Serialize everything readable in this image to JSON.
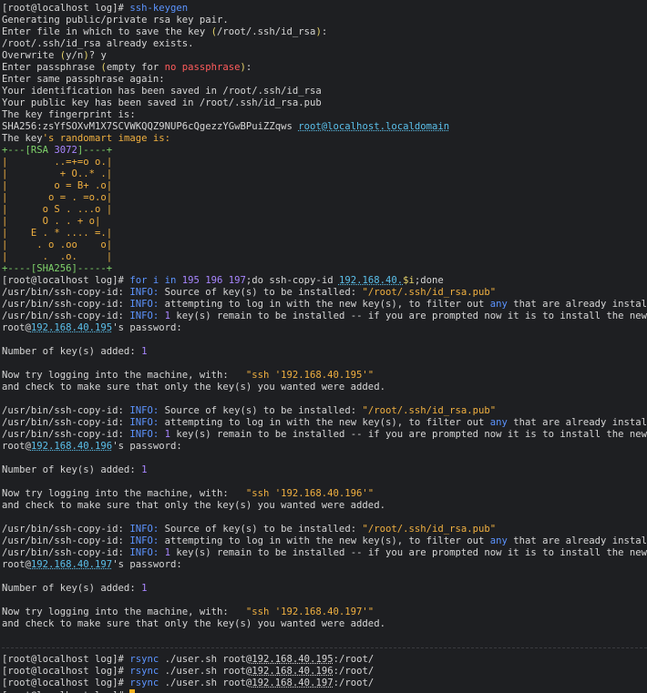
{
  "terminal": {
    "background": "#1e1f22",
    "prompt": "[root@localhost log]#",
    "colors": {
      "command": "#5c94ff",
      "info": "#5c94ff",
      "number": "#a886ff",
      "string": "#f0b040",
      "url": "#5bc0eb",
      "error": "#ff5c5c",
      "cursor": "#f2b01e"
    }
  },
  "lines": [
    {
      "kind": "text",
      "segments": [
        {
          "t": "[root@localhost log]# "
        },
        {
          "t": "ssh-keygen",
          "c": "blue"
        }
      ]
    },
    {
      "kind": "text",
      "segments": [
        {
          "t": "Generating public/private rsa key pair."
        }
      ]
    },
    {
      "kind": "text",
      "segments": [
        {
          "t": "Enter file in which to save the key "
        },
        {
          "t": "(",
          "c": "yellow"
        },
        {
          "t": "/root/.ssh/id_rsa"
        },
        {
          "t": ")",
          "c": "yellow"
        },
        {
          "t": ":"
        }
      ]
    },
    {
      "kind": "text",
      "segments": [
        {
          "t": "/root/.ssh/id_rsa already exists."
        }
      ]
    },
    {
      "kind": "text",
      "segments": [
        {
          "t": "Overwrite "
        },
        {
          "t": "(",
          "c": "yellow"
        },
        {
          "t": "y/n"
        },
        {
          "t": ")",
          "c": "yellow"
        },
        {
          "t": "? y"
        }
      ]
    },
    {
      "kind": "text",
      "segments": [
        {
          "t": "Enter passphrase "
        },
        {
          "t": "(",
          "c": "yellow"
        },
        {
          "t": "empty for "
        },
        {
          "t": "no passphrase",
          "c": "red"
        },
        {
          "t": ")",
          "c": "yellow"
        },
        {
          "t": ":"
        }
      ]
    },
    {
      "kind": "text",
      "segments": [
        {
          "t": "Enter same passphrase again:"
        }
      ]
    },
    {
      "kind": "text",
      "segments": [
        {
          "t": "Your identification has been saved in /root/.ssh/id_rsa"
        }
      ]
    },
    {
      "kind": "text",
      "segments": [
        {
          "t": "Your public key has been saved in /root/.ssh/id_rsa.pub"
        }
      ]
    },
    {
      "kind": "text",
      "segments": [
        {
          "t": "The key fingerprint is:"
        }
      ]
    },
    {
      "kind": "text",
      "segments": [
        {
          "t": "SHA256:zsYfSOXvM1X7SCVWKQQZ9NUP6cQgezzYGwBPuiZZqws "
        },
        {
          "t": "root@localhost.localdomain",
          "c": "cyan",
          "u": true
        }
      ]
    },
    {
      "kind": "text",
      "segments": [
        {
          "t": "The key"
        },
        {
          "t": "'s randomart image is:",
          "c": "orange"
        }
      ]
    },
    {
      "kind": "text",
      "segments": [
        {
          "t": "+---[RSA ",
          "c": "green"
        },
        {
          "t": "3072",
          "c": "purple"
        },
        {
          "t": "]----+",
          "c": "green"
        }
      ]
    },
    {
      "kind": "text",
      "segments": [
        {
          "t": "|",
          "c": "orange"
        },
        {
          "t": "        ..=+=o o.|",
          "c": "orange"
        }
      ]
    },
    {
      "kind": "text",
      "segments": [
        {
          "t": "|         + O..* .|",
          "c": "orange"
        }
      ]
    },
    {
      "kind": "text",
      "segments": [
        {
          "t": "|        o = B+ .o|",
          "c": "orange"
        }
      ]
    },
    {
      "kind": "text",
      "segments": [
        {
          "t": "|       o = . =o.o|",
          "c": "orange"
        }
      ]
    },
    {
      "kind": "text",
      "segments": [
        {
          "t": "|      o S . ...o |",
          "c": "orange"
        }
      ]
    },
    {
      "kind": "text",
      "segments": [
        {
          "t": "|      O . . + o|",
          "c": "orange"
        }
      ]
    },
    {
      "kind": "text",
      "segments": [
        {
          "t": "|    E . * .... =.|",
          "c": "orange"
        }
      ]
    },
    {
      "kind": "text",
      "segments": [
        {
          "t": "|     . o .oo    o|",
          "c": "orange"
        }
      ]
    },
    {
      "kind": "text",
      "segments": [
        {
          "t": "|      .  .o.     |",
          "c": "orange"
        }
      ]
    },
    {
      "kind": "text",
      "segments": [
        {
          "t": "+----[SHA256]-----+",
          "c": "green"
        }
      ]
    },
    {
      "kind": "text",
      "segments": [
        {
          "t": "[root@localhost log]# "
        },
        {
          "t": "for i in ",
          "c": "blue"
        },
        {
          "t": "195 196 197",
          "c": "purple"
        },
        {
          "t": ";do ssh-copy-id "
        },
        {
          "t": "192.168.40.",
          "c": "cyan",
          "u": true
        },
        {
          "t": "$i",
          "c": "yellow"
        },
        {
          "t": ";done"
        }
      ]
    },
    {
      "kind": "text",
      "segments": [
        {
          "t": "/usr/bin/ssh-copy-id: "
        },
        {
          "t": "INFO:",
          "c": "blue"
        },
        {
          "t": " Source of key(s) to be installed: "
        },
        {
          "t": "\"/root/.ssh/id_rsa.pub\"",
          "c": "orange"
        }
      ]
    },
    {
      "kind": "text",
      "segments": [
        {
          "t": "/usr/bin/ssh-copy-id: "
        },
        {
          "t": "INFO:",
          "c": "blue"
        },
        {
          "t": " attempting to log in with the new key(s), to filter out "
        },
        {
          "t": "any",
          "c": "blue"
        },
        {
          "t": " that are already installed"
        }
      ]
    },
    {
      "kind": "text",
      "segments": [
        {
          "t": "/usr/bin/ssh-copy-id: "
        },
        {
          "t": "INFO:",
          "c": "blue"
        },
        {
          "t": " "
        },
        {
          "t": "1",
          "c": "purple"
        },
        {
          "t": " key(s) remain to be installed -- if you are prompted now it is to install the new keys"
        }
      ]
    },
    {
      "kind": "text",
      "segments": [
        {
          "t": "root@"
        },
        {
          "t": "192.168.40.195",
          "c": "cyan",
          "u": true
        },
        {
          "t": "'s password:"
        }
      ]
    },
    {
      "kind": "blank"
    },
    {
      "kind": "text",
      "segments": [
        {
          "t": "Number of key(s) added: "
        },
        {
          "t": "1",
          "c": "purple"
        }
      ]
    },
    {
      "kind": "blank"
    },
    {
      "kind": "text",
      "segments": [
        {
          "t": "Now try logging into the machine, with:   "
        },
        {
          "t": "\"ssh '192.168.40.195'\"",
          "c": "orange"
        }
      ]
    },
    {
      "kind": "text",
      "segments": [
        {
          "t": "and check to make sure that only the key(s) you wanted were added."
        }
      ]
    },
    {
      "kind": "blank"
    },
    {
      "kind": "text",
      "segments": [
        {
          "t": "/usr/bin/ssh-copy-id: "
        },
        {
          "t": "INFO:",
          "c": "blue"
        },
        {
          "t": " Source of key(s) to be installed: "
        },
        {
          "t": "\"/root/.ssh/id_rsa.pub\"",
          "c": "orange"
        }
      ]
    },
    {
      "kind": "text",
      "segments": [
        {
          "t": "/usr/bin/ssh-copy-id: "
        },
        {
          "t": "INFO:",
          "c": "blue"
        },
        {
          "t": " attempting to log in with the new key(s), to filter out "
        },
        {
          "t": "any",
          "c": "blue"
        },
        {
          "t": " that are already installed"
        }
      ]
    },
    {
      "kind": "text",
      "segments": [
        {
          "t": "/usr/bin/ssh-copy-id: "
        },
        {
          "t": "INFO:",
          "c": "blue"
        },
        {
          "t": " "
        },
        {
          "t": "1",
          "c": "purple"
        },
        {
          "t": " key(s) remain to be installed -- if you are prompted now it is to install the new keys"
        }
      ]
    },
    {
      "kind": "text",
      "segments": [
        {
          "t": "root@"
        },
        {
          "t": "192.168.40.196",
          "c": "cyan",
          "u": true
        },
        {
          "t": "'s password:"
        }
      ]
    },
    {
      "kind": "blank"
    },
    {
      "kind": "text",
      "segments": [
        {
          "t": "Number of key(s) added: "
        },
        {
          "t": "1",
          "c": "purple"
        }
      ]
    },
    {
      "kind": "blank"
    },
    {
      "kind": "text",
      "segments": [
        {
          "t": "Now try logging into the machine, with:   "
        },
        {
          "t": "\"ssh '192.168.40.196'\"",
          "c": "orange"
        }
      ]
    },
    {
      "kind": "text",
      "segments": [
        {
          "t": "and check to make sure that only the key(s) you wanted were added."
        }
      ]
    },
    {
      "kind": "blank"
    },
    {
      "kind": "text",
      "segments": [
        {
          "t": "/usr/bin/ssh-copy-id: "
        },
        {
          "t": "INFO:",
          "c": "blue"
        },
        {
          "t": " Source of key(s) to be installed: "
        },
        {
          "t": "\"/root/.ssh/id_rsa.pub\"",
          "c": "orange"
        }
      ]
    },
    {
      "kind": "text",
      "segments": [
        {
          "t": "/usr/bin/ssh-copy-id: "
        },
        {
          "t": "INFO:",
          "c": "blue"
        },
        {
          "t": " attempting to log in with the new key(s), to filter out "
        },
        {
          "t": "any",
          "c": "blue"
        },
        {
          "t": " that are already installed"
        }
      ]
    },
    {
      "kind": "text",
      "segments": [
        {
          "t": "/usr/bin/ssh-copy-id: "
        },
        {
          "t": "INFO:",
          "c": "blue"
        },
        {
          "t": " "
        },
        {
          "t": "1",
          "c": "purple"
        },
        {
          "t": " key(s) remain to be installed -- if you are prompted now it is to install the new keys"
        }
      ]
    },
    {
      "kind": "text",
      "segments": [
        {
          "t": "root@"
        },
        {
          "t": "192.168.40.197",
          "c": "cyan",
          "u": true
        },
        {
          "t": "'s password:"
        }
      ]
    },
    {
      "kind": "blank"
    },
    {
      "kind": "text",
      "segments": [
        {
          "t": "Number of key(s) added: "
        },
        {
          "t": "1",
          "c": "purple"
        }
      ]
    },
    {
      "kind": "blank"
    },
    {
      "kind": "text",
      "segments": [
        {
          "t": "Now try logging into the machine, with:   "
        },
        {
          "t": "\"ssh '192.168.40.197'\"",
          "c": "orange"
        }
      ]
    },
    {
      "kind": "text",
      "segments": [
        {
          "t": "and check to make sure that only the key(s) you wanted were added."
        }
      ]
    },
    {
      "kind": "blank"
    },
    {
      "kind": "sep"
    },
    {
      "kind": "text",
      "segments": [
        {
          "t": "[root@localhost log]# "
        },
        {
          "t": "rsync",
          "c": "blue"
        },
        {
          "t": " ./user.sh root@"
        },
        {
          "t": "192.168.40.195",
          "c": "plain",
          "u": true
        },
        {
          "t": ":/root/"
        }
      ]
    },
    {
      "kind": "text",
      "segments": [
        {
          "t": "[root@localhost log]# "
        },
        {
          "t": "rsync",
          "c": "blue"
        },
        {
          "t": " ./user.sh root@"
        },
        {
          "t": "192.168.40.196",
          "c": "plain",
          "u": true
        },
        {
          "t": ":/root/"
        }
      ]
    },
    {
      "kind": "text",
      "segments": [
        {
          "t": "[root@localhost log]# "
        },
        {
          "t": "rsync",
          "c": "blue"
        },
        {
          "t": " ./user.sh root@"
        },
        {
          "t": "192.168.40.197",
          "c": "plain",
          "u": true
        },
        {
          "t": ":/root/"
        }
      ]
    },
    {
      "kind": "prompt",
      "segments": [
        {
          "t": "[root@localhost log]# "
        }
      ]
    }
  ]
}
